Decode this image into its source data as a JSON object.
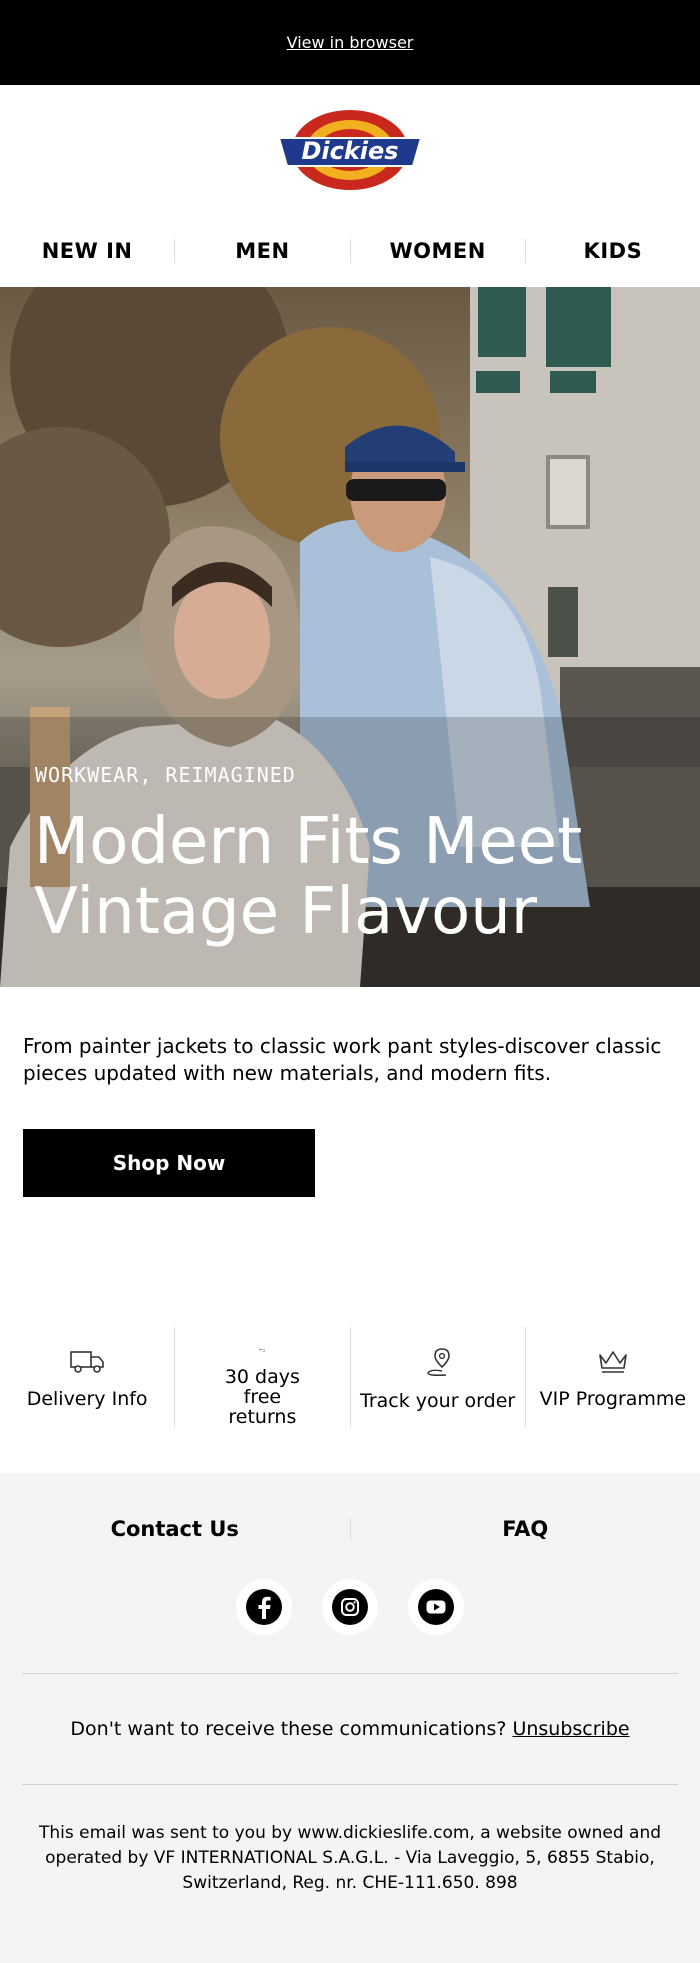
{
  "topbar": {
    "view_in_browser": "View in browser"
  },
  "brand": {
    "logo_text": "Dickies",
    "colors": {
      "red": "#c8281e",
      "yellow": "#f2b01e",
      "navy": "#1f3a8c"
    }
  },
  "nav": {
    "items": [
      "NEW IN",
      "MEN",
      "WOMEN",
      "KIDS"
    ]
  },
  "hero": {
    "eyebrow": "WORKWEAR, REIMAGINED",
    "headline": "Modern Fits Meet Vintage Flavour"
  },
  "intro": {
    "text": "From painter jackets to classic work pant styles-discover classic pieces updated with new materials, and modern fits."
  },
  "cta": {
    "label": "Shop Now"
  },
  "services": [
    {
      "icon": "truck-icon",
      "label": "Delivery Info"
    },
    {
      "icon": "return-arrow-icon",
      "label": "30 days free returns"
    },
    {
      "icon": "location-pin-icon",
      "label": "Track your order"
    },
    {
      "icon": "crown-icon",
      "label": "VIP Programme"
    }
  ],
  "footer": {
    "links": [
      "Contact Us",
      "FAQ"
    ],
    "socials": [
      "facebook-icon",
      "instagram-icon",
      "youtube-icon"
    ],
    "unsubscribe_prompt": "Don't want to receive these communications?",
    "unsubscribe_link": "Unsubscribe",
    "legal": "This email was sent to you by www.dickieslife.com, a website owned and operated by VF INTERNATIONAL S.A.G.L. - Via Laveggio, 5, 6855 Stabio, Switzerland, Reg. nr. CHE-111.650. 898"
  }
}
